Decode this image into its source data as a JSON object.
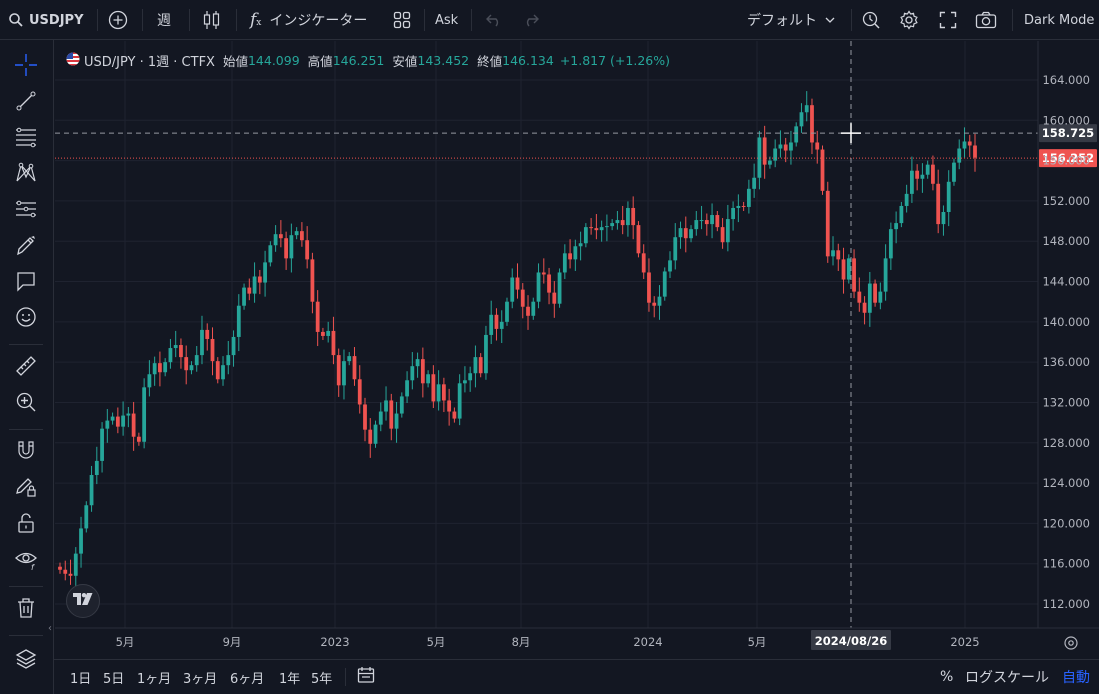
{
  "toolbar": {
    "symbol": "USDJPY",
    "interval": "週",
    "indicators": "インジケーター",
    "price_type": "Ask",
    "layout": "デフォルト",
    "theme": "Dark Mode"
  },
  "legend": {
    "title": "USD/JPY · 1週 · CTFX",
    "open_label": "始値",
    "open": "144.099",
    "high_label": "高値",
    "high": "146.251",
    "low_label": "安値",
    "low": "143.452",
    "close_label": "終値",
    "close": "146.134",
    "change": "+1.817 (+1.26%)"
  },
  "crosshair": {
    "price": "158.725",
    "date": "2024/08/26"
  },
  "last_price": "156.252",
  "bottom": {
    "ranges": [
      "1日",
      "5日",
      "1ヶ月",
      "3ヶ月",
      "6ヶ月",
      "1年",
      "5年"
    ],
    "percent": "%",
    "log_scale": "ログスケール",
    "auto": "自動"
  },
  "colors": {
    "up": "#26a69a",
    "down": "#ef5350",
    "bg": "#131722",
    "accent": "#2962ff"
  },
  "chart_data": {
    "type": "candlestick",
    "interval": "1W",
    "symbol": "USD/JPY",
    "y_ticks": [
      164,
      160,
      156,
      152,
      148,
      144,
      140,
      136,
      132,
      128,
      124,
      120,
      116,
      112
    ],
    "x_ticks": [
      "5月",
      "9月",
      "2023",
      "5月",
      "8月",
      "2024",
      "5月",
      "2025"
    ],
    "ylim": [
      110,
      166
    ],
    "grid": true,
    "last_price": 156.252,
    "crosshair_price": 158.725,
    "crosshair_date": "2024/08/26",
    "closes": [
      115.4,
      115.0,
      114.8,
      117.0,
      119.5,
      121.8,
      124.8,
      126.2,
      129.4,
      130.2,
      130.6,
      129.6,
      130.7,
      130.9,
      128.6,
      128.1,
      133.5,
      134.8,
      135.9,
      135.0,
      136.0,
      137.4,
      137.7,
      136.5,
      135.2,
      135.7,
      136.7,
      139.2,
      138.3,
      136.1,
      134.3,
      135.7,
      136.7,
      138.5,
      141.6,
      143.4,
      142.8,
      144.5,
      143.9,
      145.9,
      147.6,
      148.7,
      148.3,
      146.3,
      148.6,
      149.0,
      148.1,
      146.2,
      142.0,
      139.0,
      138.6,
      139.1,
      136.7,
      133.7,
      136.1,
      136.6,
      134.3,
      131.8,
      129.3,
      127.9,
      129.8,
      131.1,
      132.2,
      129.4,
      130.9,
      132.6,
      134.2,
      135.6,
      136.3,
      133.9,
      134.8,
      132.1,
      133.8,
      132.2,
      131.1,
      130.4,
      133.9,
      134.2,
      134.9,
      136.5,
      134.9,
      138.7,
      140.7,
      139.3,
      140.0,
      142.0,
      144.4,
      143.2,
      141.5,
      140.6,
      142.0,
      144.9,
      144.7,
      142.9,
      141.8,
      144.9,
      146.8,
      146.2,
      147.5,
      147.8,
      149.4,
      149.3,
      149.1,
      149.4,
      149.5,
      149.8,
      150.1,
      149.6,
      151.3,
      149.6,
      146.8,
      144.9,
      141.9,
      141.6,
      142.5,
      145.0,
      146.1,
      148.4,
      149.3,
      148.3,
      149.2,
      150.1,
      150.1,
      149.7,
      150.6,
      149.4,
      147.9,
      150.2,
      151.3,
      151.5,
      151.4,
      153.2,
      154.3,
      158.3,
      155.6,
      156.0,
      157.2,
      157.6,
      157.0,
      157.8,
      159.4,
      160.8,
      161.5,
      157.8,
      157.1,
      153.0,
      146.5,
      147.1,
      146.2,
      144.2,
      146.3,
      143.0,
      141.9,
      140.9,
      143.8,
      141.9,
      143.0,
      146.3,
      149.2,
      149.8,
      151.5,
      152.7,
      155.0,
      154.2,
      154.6,
      155.6,
      153.7,
      149.7,
      150.9,
      153.9,
      155.8,
      157.2,
      157.9,
      157.5,
      156.3
    ]
  }
}
